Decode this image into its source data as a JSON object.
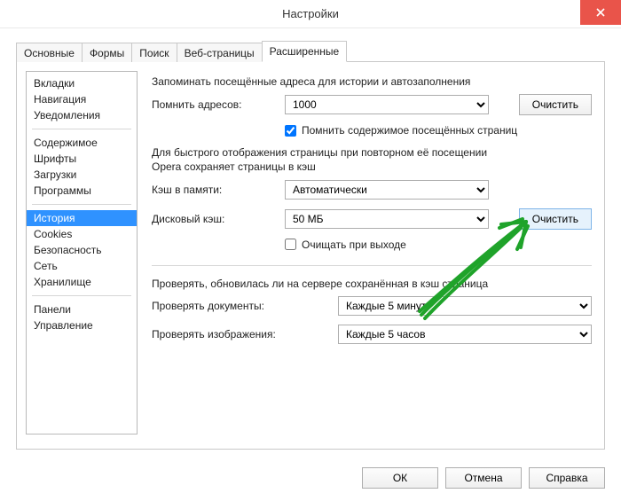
{
  "window": {
    "title": "Настройки"
  },
  "tabs": {
    "items": [
      {
        "label": "Основные"
      },
      {
        "label": "Формы"
      },
      {
        "label": "Поиск"
      },
      {
        "label": "Веб-страницы"
      },
      {
        "label": "Расширенные"
      }
    ],
    "selected": 4
  },
  "sidebar": {
    "groups": [
      [
        "Вкладки",
        "Навигация",
        "Уведомления"
      ],
      [
        "Содержимое",
        "Шрифты",
        "Загрузки",
        "Программы"
      ],
      [
        "История",
        "Cookies",
        "Безопасность",
        "Сеть",
        "Хранилище"
      ],
      [
        "Панели",
        "Управление"
      ]
    ],
    "selected": "История"
  },
  "settings": {
    "remember_header": "Запоминать посещённые адреса для истории и автозаполнения",
    "remember_addresses_label": "Помнить адресов:",
    "remember_addresses_value": "1000",
    "clear_label": "Очистить",
    "remember_content_checked": true,
    "remember_content_label": "Помнить содержимое посещённых страниц",
    "cache_desc": "Для быстрого отображения страницы при повторном её посещении Opera сохраняет страницы в кэш",
    "mem_cache_label": "Кэш в памяти:",
    "mem_cache_value": "Автоматически",
    "disk_cache_label": "Дисковый кэш:",
    "disk_cache_value": "50 МБ",
    "clear_on_exit_checked": false,
    "clear_on_exit_label": "Очищать при выходе",
    "check_header": "Проверять, обновилась ли на сервере сохранённая в кэш страница",
    "check_docs_label": "Проверять документы:",
    "check_docs_value": "Каждые 5 минут",
    "check_imgs_label": "Проверять изображения:",
    "check_imgs_value": "Каждые 5 часов"
  },
  "footer": {
    "ok": "ОК",
    "cancel": "Отмена",
    "help": "Справка"
  }
}
